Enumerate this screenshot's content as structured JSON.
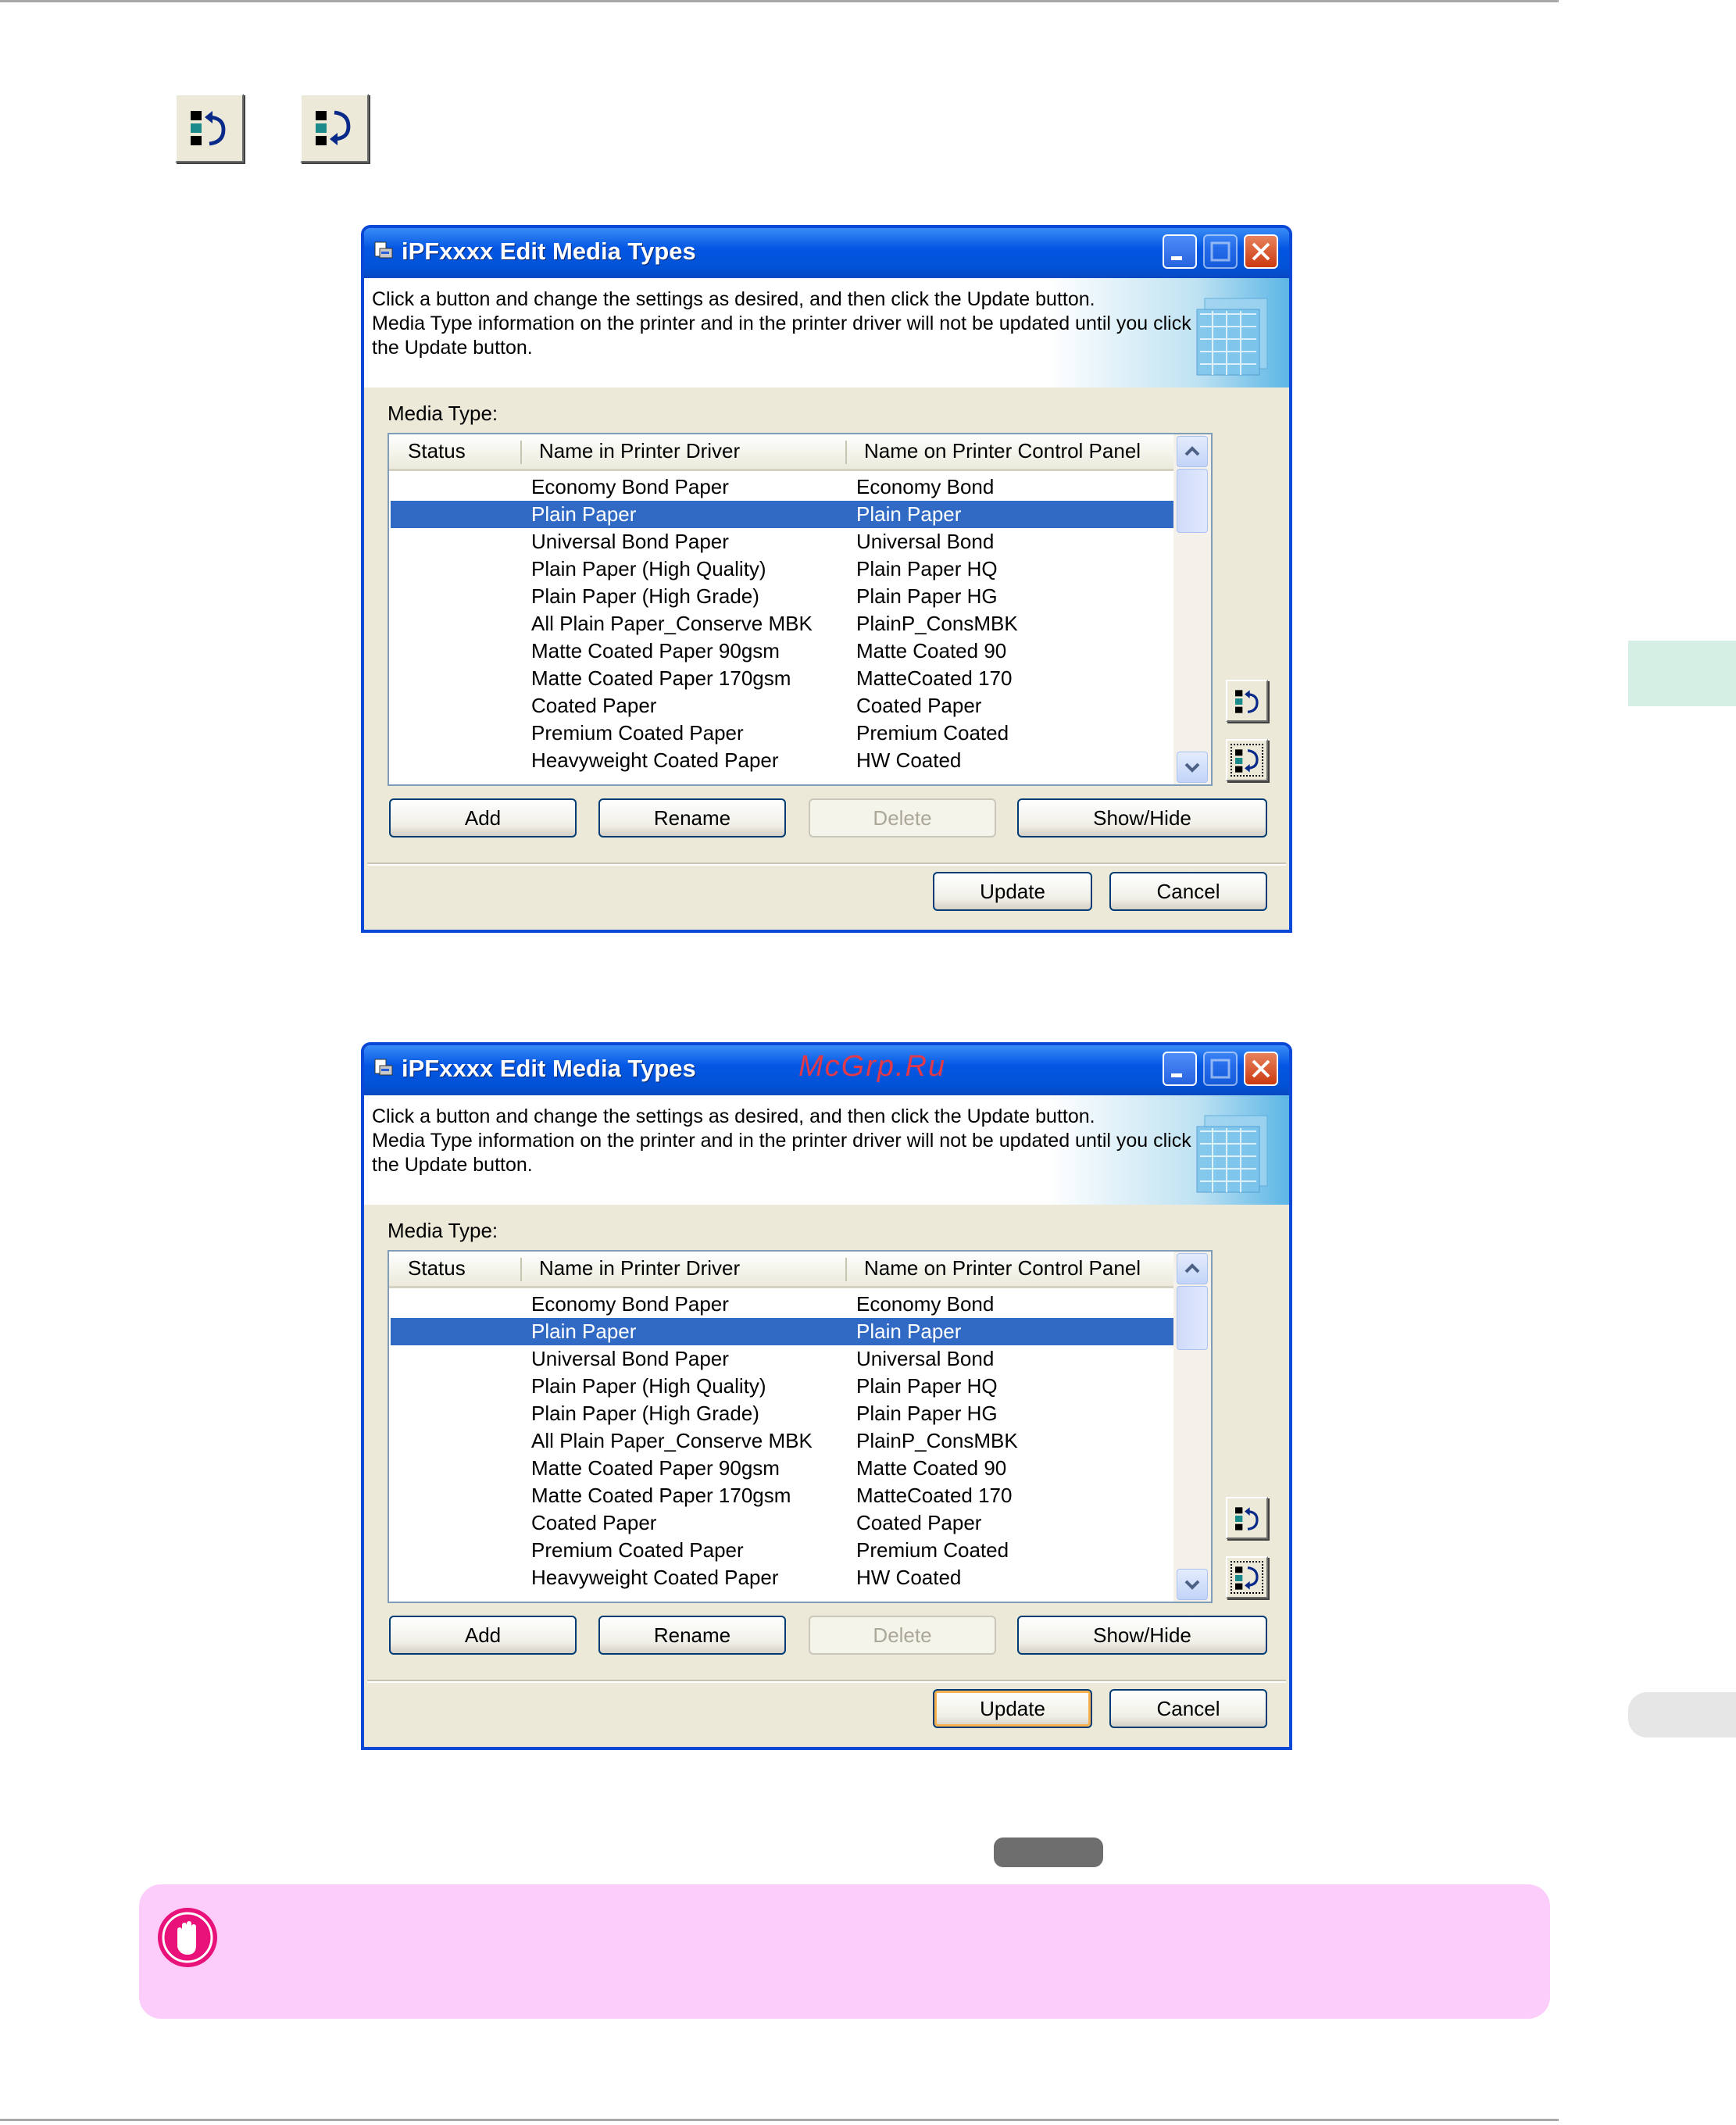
{
  "dialogs": [
    {
      "title": "iPFxxxx Edit Media Types",
      "watermark": "",
      "banner_lines": [
        "Click a button and change the settings as desired, and then click the Update button.",
        "Media Type information on the printer and in the printer driver will not be updated until you click",
        "the Update button."
      ],
      "media_type_label": "Media Type:",
      "columns": [
        "Status",
        "Name in Printer Driver",
        "Name on Printer Control Panel"
      ],
      "rows": [
        {
          "status": "",
          "driver": "Economy Bond Paper",
          "panel": "Economy Bond"
        },
        {
          "status": "",
          "driver": "Plain Paper",
          "panel": "Plain Paper"
        },
        {
          "status": "",
          "driver": "Universal Bond Paper",
          "panel": "Universal Bond"
        },
        {
          "status": "",
          "driver": "Plain Paper (High Quality)",
          "panel": "Plain Paper HQ"
        },
        {
          "status": "",
          "driver": "Plain Paper (High Grade)",
          "panel": "Plain Paper HG"
        },
        {
          "status": "",
          "driver": "All Plain Paper_Conserve MBK",
          "panel": "PlainP_ConsMBK"
        },
        {
          "status": "",
          "driver": "Matte Coated Paper 90gsm",
          "panel": "Matte Coated 90"
        },
        {
          "status": "",
          "driver": "Matte Coated Paper 170gsm",
          "panel": "MatteCoated 170"
        },
        {
          "status": "",
          "driver": "Coated Paper",
          "panel": "Coated Paper"
        },
        {
          "status": "",
          "driver": "Premium Coated Paper",
          "panel": "Premium Coated"
        },
        {
          "status": "",
          "driver": "Heavyweight Coated Paper",
          "panel": "HW Coated"
        }
      ],
      "selected_row": 1,
      "buttons": {
        "add": "Add",
        "rename": "Rename",
        "delete": "Delete",
        "show_hide": "Show/Hide",
        "update": "Update",
        "cancel": "Cancel"
      }
    },
    {
      "title": "iPFxxxx Edit Media Types",
      "watermark": "McGrp.Ru",
      "banner_lines": [
        "Click a button and change the settings as desired, and then click the Update button.",
        "Media Type information on the printer and in the printer driver will not be updated until you click",
        "the Update button."
      ],
      "media_type_label": "Media Type:",
      "columns": [
        "Status",
        "Name in Printer Driver",
        "Name on Printer Control Panel"
      ],
      "rows": [
        {
          "status": "",
          "driver": "Economy Bond Paper",
          "panel": "Economy Bond"
        },
        {
          "status": "",
          "driver": "Plain Paper",
          "panel": "Plain Paper"
        },
        {
          "status": "",
          "driver": "Universal Bond Paper",
          "panel": "Universal Bond"
        },
        {
          "status": "",
          "driver": "Plain Paper (High Quality)",
          "panel": "Plain Paper HQ"
        },
        {
          "status": "",
          "driver": "Plain Paper (High Grade)",
          "panel": "Plain Paper HG"
        },
        {
          "status": "",
          "driver": "All Plain Paper_Conserve MBK",
          "panel": "PlainP_ConsMBK"
        },
        {
          "status": "",
          "driver": "Matte Coated Paper 90gsm",
          "panel": "Matte Coated 90"
        },
        {
          "status": "",
          "driver": "Matte Coated Paper 170gsm",
          "panel": "MatteCoated 170"
        },
        {
          "status": "",
          "driver": "Coated Paper",
          "panel": "Coated Paper"
        },
        {
          "status": "",
          "driver": "Premium Coated Paper",
          "panel": "Premium Coated"
        },
        {
          "status": "",
          "driver": "Heavyweight Coated Paper",
          "panel": "HW Coated"
        }
      ],
      "selected_row": 1,
      "buttons": {
        "add": "Add",
        "rename": "Rename",
        "delete": "Delete",
        "show_hide": "Show/Hide",
        "update": "Update",
        "cancel": "Cancel"
      }
    }
  ],
  "icons": {
    "toolbar": [
      "move-up-icon",
      "move-down-icon"
    ],
    "important": "hand-stop-icon"
  },
  "colors": {
    "title_bar": "#0457e4",
    "selection": "#316ac5",
    "important_box": "#fccdfb",
    "side_tab": "#d6efe4"
  }
}
